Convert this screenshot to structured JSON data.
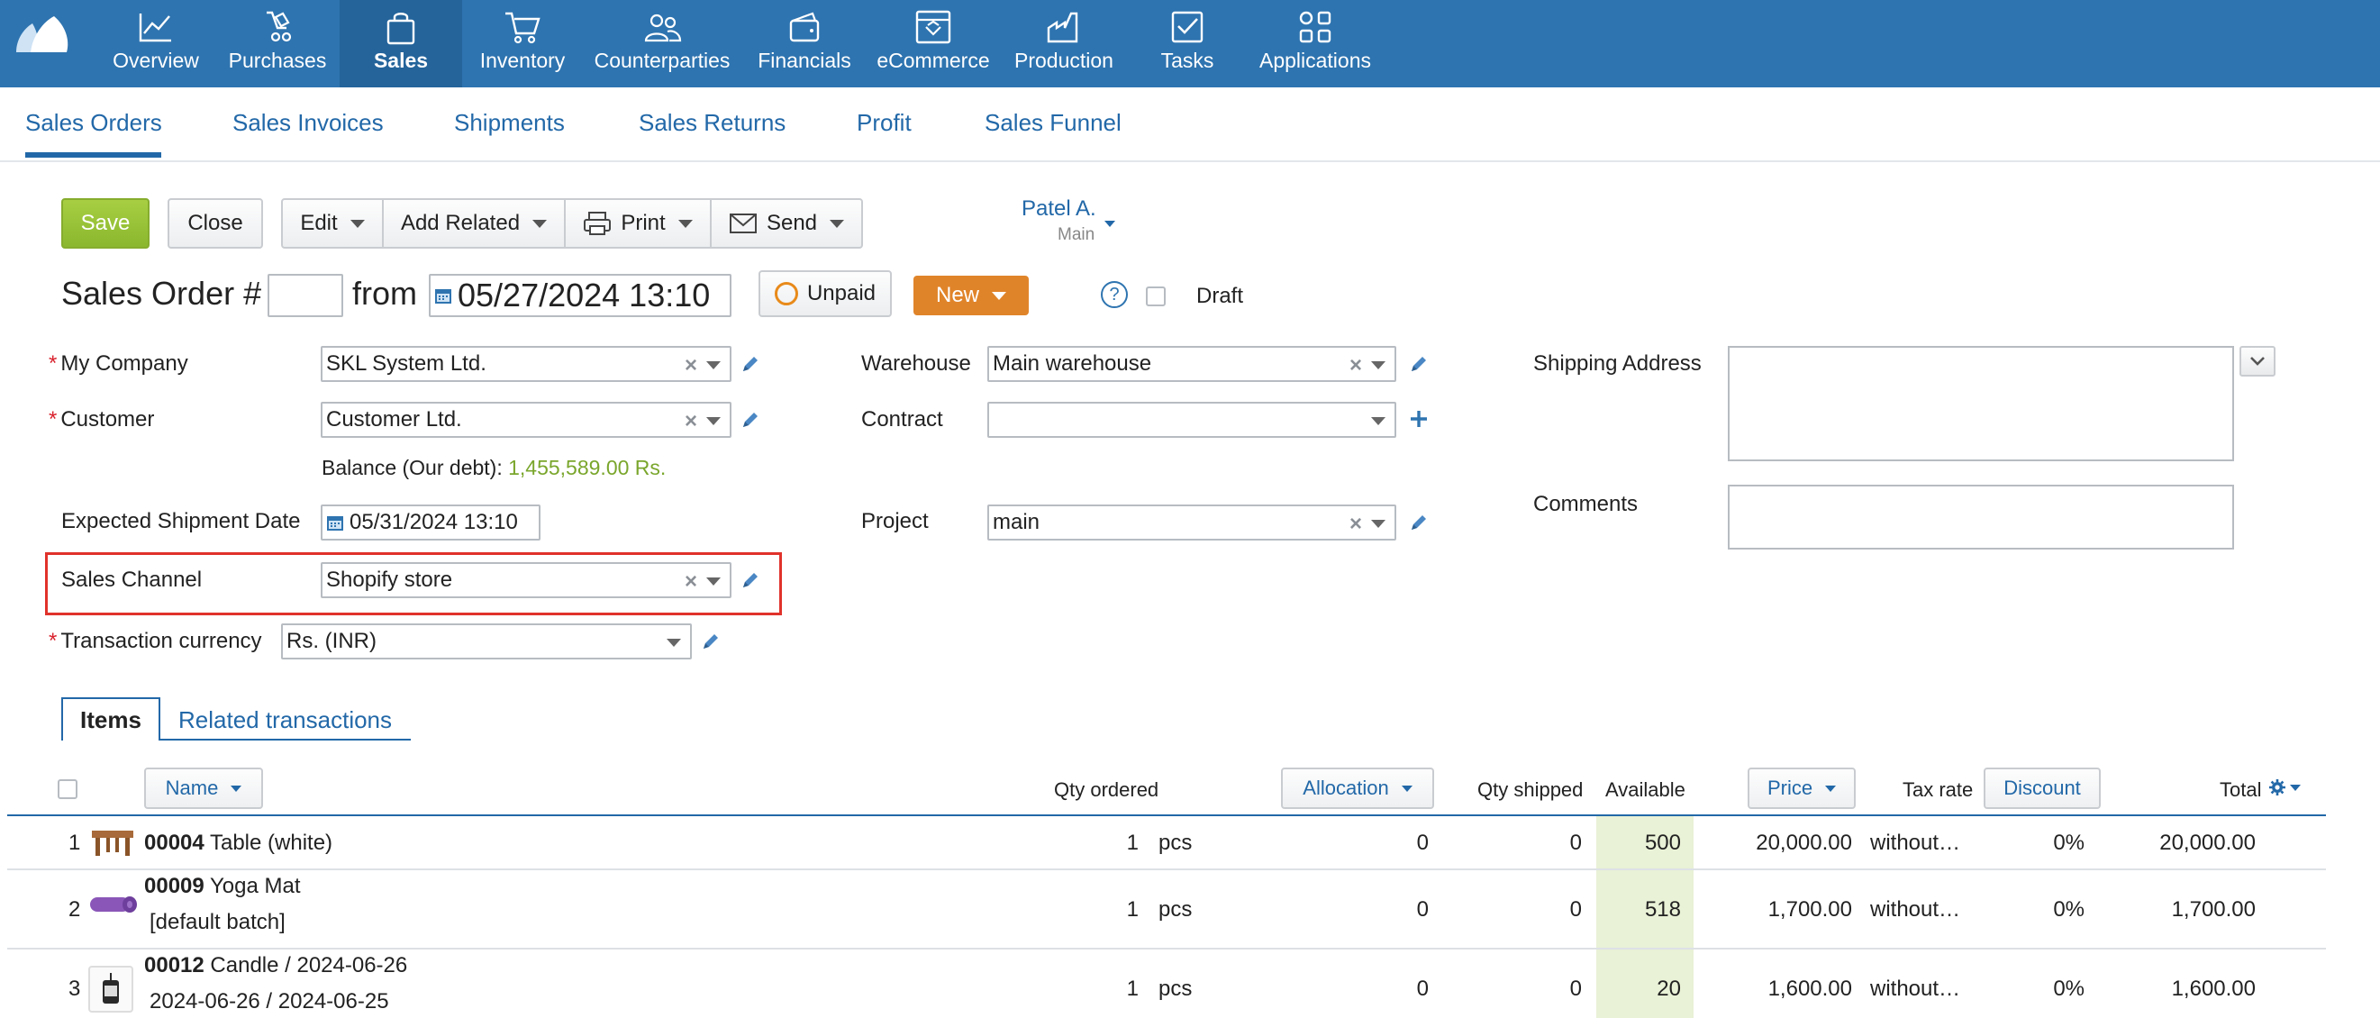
{
  "nav": {
    "items": [
      {
        "label": "Overview",
        "icon": "chart-line-icon"
      },
      {
        "label": "Purchases",
        "icon": "purchases-icon"
      },
      {
        "label": "Sales",
        "icon": "shopping-bag-icon"
      },
      {
        "label": "Inventory",
        "icon": "cart-icon"
      },
      {
        "label": "Counterparties",
        "icon": "people-icon"
      },
      {
        "label": "Financials",
        "icon": "wallet-icon"
      },
      {
        "label": "eCommerce",
        "icon": "storefront-icon"
      },
      {
        "label": "Production",
        "icon": "factory-icon"
      },
      {
        "label": "Tasks",
        "icon": "checkbox-icon"
      },
      {
        "label": "Applications",
        "icon": "apps-grid-icon"
      }
    ],
    "active": "Sales"
  },
  "subnav": {
    "tabs": [
      "Sales Orders",
      "Sales Invoices",
      "Shipments",
      "Sales Returns",
      "Profit",
      "Sales Funnel"
    ],
    "active": "Sales Orders"
  },
  "toolbar": {
    "save": "Save",
    "close": "Close",
    "edit": "Edit",
    "add_related": "Add Related",
    "print": "Print",
    "send": "Send"
  },
  "owner": {
    "name": "Patel A.",
    "group": "Main"
  },
  "header": {
    "title": "Sales Order #",
    "number": "",
    "from": "from",
    "date": "05/27/2024 13:10",
    "payment_status": "Unpaid",
    "status": "New",
    "help": "?",
    "draft_label": "Draft"
  },
  "form": {
    "my_company": {
      "label": "My Company",
      "value": "SKL System Ltd."
    },
    "customer": {
      "label": "Customer",
      "value": "Customer Ltd."
    },
    "balance": {
      "label": "Balance (Our debt):",
      "value": "1,455,589.00 Rs."
    },
    "shipment_date": {
      "label": "Expected Shipment Date",
      "value": "05/31/2024 13:10"
    },
    "sales_channel": {
      "label": "Sales Channel",
      "value": "Shopify store"
    },
    "currency": {
      "label": "Transaction currency",
      "value": "Rs. (INR)"
    },
    "warehouse": {
      "label": "Warehouse",
      "value": "Main warehouse"
    },
    "contract": {
      "label": "Contract",
      "value": ""
    },
    "project": {
      "label": "Project",
      "value": "main"
    },
    "shipping_address": {
      "label": "Shipping Address",
      "value": ""
    },
    "comments": {
      "label": "Comments",
      "value": ""
    }
  },
  "tabs": {
    "items": "Items",
    "related": "Related transactions"
  },
  "table": {
    "headers": {
      "name": "Name",
      "qty_ordered": "Qty ordered",
      "allocation": "Allocation",
      "qty_shipped": "Qty shipped",
      "available": "Available",
      "price": "Price",
      "tax_rate": "Tax rate",
      "discount": "Discount",
      "total": "Total"
    },
    "rows": [
      {
        "num": "1",
        "code": "00004",
        "name": "Table (white)",
        "sub": "",
        "qty": "1",
        "unit": "pcs",
        "allocation": "0",
        "shipped": "0",
        "available": "500",
        "price": "20,000.00",
        "tax": "without…",
        "discount": "0%",
        "total": "20,000.00",
        "thumb": "table-thumbnail"
      },
      {
        "num": "2",
        "code": "00009",
        "name": "Yoga Mat",
        "sub": "[default batch]",
        "qty": "1",
        "unit": "pcs",
        "allocation": "0",
        "shipped": "0",
        "available": "518",
        "price": "1,700.00",
        "tax": "without…",
        "discount": "0%",
        "total": "1,700.00",
        "thumb": "yoga-mat-thumbnail"
      },
      {
        "num": "3",
        "code": "00012",
        "name": "Candle / 2024-06-26",
        "sub": "2024-06-26 / 2024-06-25",
        "qty": "1",
        "unit": "pcs",
        "allocation": "0",
        "shipped": "0",
        "available": "20",
        "price": "1,600.00",
        "tax": "without…",
        "discount": "0%",
        "total": "1,600.00",
        "thumb": "candle-thumbnail"
      }
    ]
  },
  "colors": {
    "nav_bg": "#2e74b0",
    "accent": "#2268a8",
    "save": "#9bc43a",
    "status_new": "#e0842a",
    "balance": "#7aa62c",
    "highlight": "#e0322b"
  }
}
